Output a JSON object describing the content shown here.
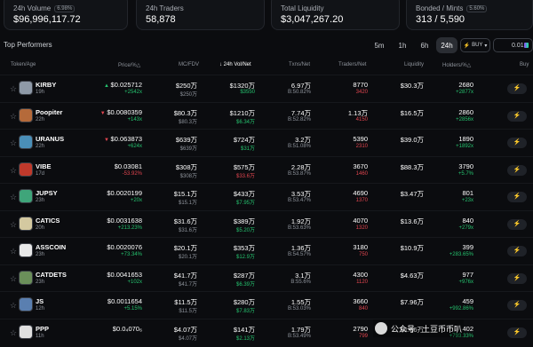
{
  "stats": [
    {
      "label": "24h Volume",
      "badge": "6.98%",
      "value": "$96,996,117.72"
    },
    {
      "label": "24h Traders",
      "badge": "",
      "value": "58,878"
    },
    {
      "label": "Total Liquidity",
      "badge": "",
      "value": "$3,047,267.20"
    },
    {
      "label": "Bonded / Mints",
      "badge": "5.60%",
      "value": "313 / 5,590"
    }
  ],
  "section_title": "Top Performers",
  "timeframes": [
    "5m",
    "1h",
    "6h",
    "24h"
  ],
  "active_timeframe": "24h",
  "buy_mode": "BUY",
  "buy_amount": "0.01",
  "columns": {
    "token": "Token/Age",
    "price": "Price/%△",
    "mc": "MC/FDV",
    "vol": "↓ 24h Vol/Net",
    "txns": "Txns/Net",
    "traders": "Traders/Net",
    "liquidity": "Liquidity",
    "holders": "Holders/%△",
    "buy": "Buy"
  },
  "rows": [
    {
      "name": "KIRBY",
      "age": "19h",
      "logo_color": "#8f9aa8",
      "price": "$0.025712",
      "price_dir": "up",
      "price_change": "+2542x",
      "mc": "$250万",
      "fdv": "$250万",
      "vol": "$1320万",
      "vol_net": "$3550",
      "vol_net_dir": "up",
      "txns": "6.97万",
      "txns_net": "B:50.82%",
      "traders": "8770",
      "traders_net": "3420",
      "liquidity": "$30.3万",
      "holders": "2680",
      "holders_change": "+2877x"
    },
    {
      "name": "Poopiter",
      "age": "22h",
      "logo_color": "#b56a3a",
      "price": "$0.0080359",
      "price_dir": "down",
      "price_change": "+143x",
      "mc": "$80.3万",
      "fdv": "$80.3万",
      "vol": "$1210万",
      "vol_net": "$6.34万",
      "vol_net_dir": "up",
      "txns": "7.74万",
      "txns_net": "B:52.82%",
      "traders": "1.13万",
      "traders_net": "4150",
      "liquidity": "$16.5万",
      "holders": "2860",
      "holders_change": "+2856x"
    },
    {
      "name": "URANUS",
      "age": "22h",
      "logo_color": "#4a8fb8",
      "price": "$0.063873",
      "price_dir": "down",
      "price_change": "+624x",
      "mc": "$639万",
      "fdv": "$639万",
      "vol": "$724万",
      "vol_net": "$31万",
      "vol_net_dir": "up",
      "txns": "3.2万",
      "txns_net": "B:51.08%",
      "traders": "5390",
      "traders_net": "2310",
      "liquidity": "$39.0万",
      "holders": "1890",
      "holders_change": "+1892x"
    },
    {
      "name": "VIBE",
      "age": "17d",
      "logo_color": "#c0392b",
      "price": "$0.03081",
      "price_dir": "none",
      "price_change": "-53.92%",
      "mc": "$308万",
      "fdv": "$308万",
      "vol": "$575万",
      "vol_net": "$33.6万",
      "vol_net_dir": "down",
      "txns": "2.28万",
      "txns_net": "B:53.87%",
      "traders": "3670",
      "traders_net": "1460",
      "liquidity": "$88.3万",
      "holders": "3790",
      "holders_change": "+5.7%"
    },
    {
      "name": "JUPSY",
      "age": "23h",
      "logo_color": "#3fa57a",
      "price": "$0.0020199",
      "price_dir": "none",
      "price_change": "+20x",
      "mc": "$15.1万",
      "fdv": "$15.1万",
      "vol": "$433万",
      "vol_net": "$7.95万",
      "vol_net_dir": "up",
      "txns": "3.53万",
      "txns_net": "B:53.47%",
      "traders": "4690",
      "traders_net": "1370",
      "liquidity": "$3.47万",
      "holders": "801",
      "holders_change": "+23x"
    },
    {
      "name": "CATICS",
      "age": "20h",
      "logo_color": "#d4c9a0",
      "price": "$0.0031638",
      "price_dir": "none",
      "price_change": "+213.23%",
      "mc": "$31.6万",
      "fdv": "$31.6万",
      "vol": "$389万",
      "vol_net": "$5.20万",
      "vol_net_dir": "up",
      "txns": "1.92万",
      "txns_net": "B:53.63%",
      "traders": "4070",
      "traders_net": "1320",
      "liquidity": "$13.6万",
      "holders": "840",
      "holders_change": "+279x"
    },
    {
      "name": "ASSCOIN",
      "age": "23h",
      "logo_color": "#e8e8e8",
      "price": "$0.0020076",
      "price_dir": "none",
      "price_change": "+73.34%",
      "mc": "$20.1万",
      "fdv": "$20.1万",
      "vol": "$353万",
      "vol_net": "$12.9万",
      "vol_net_dir": "up",
      "txns": "1.36万",
      "txns_net": "B:54.57%",
      "traders": "3180",
      "traders_net": "750",
      "liquidity": "$10.9万",
      "holders": "399",
      "holders_change": "+283.65%"
    },
    {
      "name": "CATDETS",
      "age": "23h",
      "logo_color": "#6b8f5a",
      "price": "$0.0041653",
      "price_dir": "none",
      "price_change": "+102x",
      "mc": "$41.7万",
      "fdv": "$41.7万",
      "vol": "$287万",
      "vol_net": "$6.39万",
      "vol_net_dir": "up",
      "txns": "3.1万",
      "txns_net": "B:55.6%",
      "traders": "4300",
      "traders_net": "1120",
      "liquidity": "$4.63万",
      "holders": "977",
      "holders_change": "+976x"
    },
    {
      "name": "JS",
      "age": "12h",
      "logo_color": "#5a7fb0",
      "price": "$0.0011654",
      "price_dir": "none",
      "price_change": "+5.15%",
      "mc": "$11.5万",
      "fdv": "$11.5万",
      "vol": "$280万",
      "vol_net": "$7.83万",
      "vol_net_dir": "up",
      "txns": "1.55万",
      "txns_net": "B:53.03%",
      "traders": "3660",
      "traders_net": "840",
      "liquidity": "$7.96万",
      "holders": "459",
      "holders_change": "+992.86%"
    },
    {
      "name": "PPP",
      "age": "11h",
      "logo_color": "#e0e0e0",
      "price": "$0.0₄070₆",
      "price_dir": "none",
      "price_change": "",
      "mc": "$4.07万",
      "fdv": "$4.07万",
      "vol": "$141万",
      "vol_net": "$2.13万",
      "vol_net_dir": "up",
      "txns": "1.79万",
      "txns_net": "B:53.49%",
      "traders": "2790",
      "traders_net": "799",
      "liquidity": "$1.66万",
      "holders": "402",
      "holders_change": "+793.33%"
    }
  ],
  "watermark": "公众号 · 土豆币币叭",
  "icons": {
    "star": "star-icon",
    "buy": "lightning-icon",
    "sort": "sort-arrow-icon"
  }
}
